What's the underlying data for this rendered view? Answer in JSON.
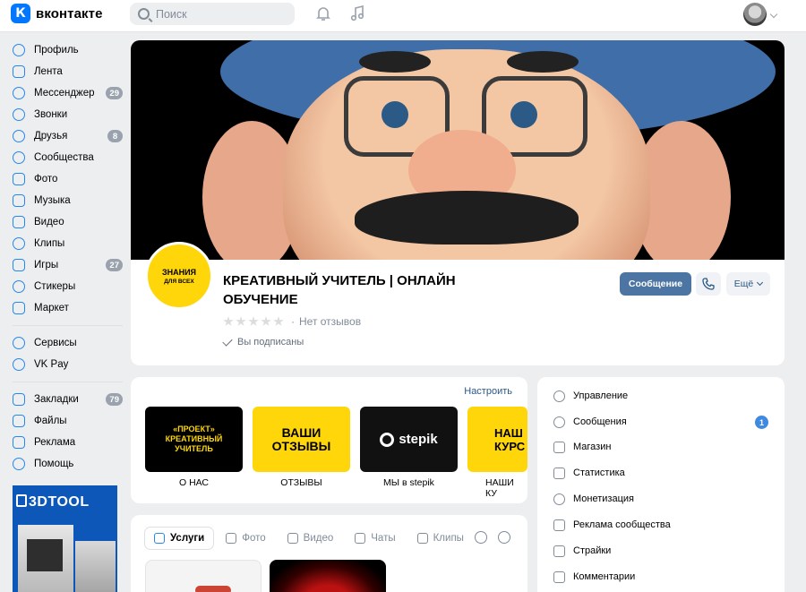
{
  "header": {
    "logo_text": "вконтакте",
    "logo_mark": "К",
    "search_placeholder": "Поиск",
    "icons": [
      "bell-icon",
      "music-note-icon",
      "chevron-down-icon"
    ]
  },
  "sidebar": {
    "items": [
      {
        "label": "Профиль",
        "icon": "user-circle-icon",
        "badge": ""
      },
      {
        "label": "Лента",
        "icon": "news-feed-icon",
        "badge": ""
      },
      {
        "label": "Мессенджер",
        "icon": "message-icon",
        "badge": "29"
      },
      {
        "label": "Звонки",
        "icon": "phone-icon",
        "badge": ""
      },
      {
        "label": "Друзья",
        "icon": "friends-icon",
        "badge": "8"
      },
      {
        "label": "Сообщества",
        "icon": "communities-icon",
        "badge": ""
      },
      {
        "label": "Фото",
        "icon": "photo-icon",
        "badge": ""
      },
      {
        "label": "Музыка",
        "icon": "music-icon",
        "badge": ""
      },
      {
        "label": "Видео",
        "icon": "video-icon",
        "badge": ""
      },
      {
        "label": "Клипы",
        "icon": "clips-icon",
        "badge": ""
      },
      {
        "label": "Игры",
        "icon": "games-icon",
        "badge": "27"
      },
      {
        "label": "Стикеры",
        "icon": "stickers-icon",
        "badge": ""
      },
      {
        "label": "Маркет",
        "icon": "market-icon",
        "badge": ""
      }
    ],
    "items2": [
      {
        "label": "Сервисы",
        "icon": "services-icon"
      },
      {
        "label": "VK Pay",
        "icon": "vk-pay-icon"
      }
    ],
    "items3": [
      {
        "label": "Закладки",
        "icon": "bookmark-icon",
        "badge": "79"
      },
      {
        "label": "Файлы",
        "icon": "file-icon",
        "badge": ""
      },
      {
        "label": "Реклама",
        "icon": "megaphone-icon",
        "badge": ""
      },
      {
        "label": "Помощь",
        "icon": "help-icon",
        "badge": ""
      }
    ],
    "ad": {
      "brand": "3DTOOL"
    }
  },
  "group": {
    "avatar_line1": "ЗНАНИЯ",
    "avatar_line2": "ДЛЯ ВСЕХ",
    "title": "КРЕАТИВНЫЙ УЧИТЕЛЬ | ОНЛАЙН ОБУЧЕНИЕ",
    "rating_stars": 0,
    "rating_sep": "·",
    "rating_text": "Нет отзывов",
    "subscribed_text": "Вы подписаны",
    "message_button": "Сообщение",
    "more_button": "Ещё"
  },
  "links": {
    "configure": "Настроить",
    "tile1_lines": [
      "«ПРОЕКТ»",
      "КРЕАТИВНЫЙ",
      "УЧИТЕЛЬ"
    ],
    "tile2_lines": [
      "ВАШИ",
      "ОТЗЫВЫ"
    ],
    "tile3_text": "stepik",
    "tile4_lines": [
      "НАШ",
      "КУРС"
    ],
    "labels": [
      "О НАС",
      "ОТЗЫВЫ",
      "МЫ в stepik",
      "НАШИ КУ"
    ]
  },
  "tabs": [
    {
      "label": "Услуги",
      "icon": "services-check-icon",
      "active": true
    },
    {
      "label": "Фото",
      "icon": "photo-icon",
      "active": false
    },
    {
      "label": "Видео",
      "icon": "video-icon",
      "active": false
    },
    {
      "label": "Чаты",
      "icon": "chats-icon",
      "active": false
    },
    {
      "label": "Клипы",
      "icon": "clips-icon",
      "active": false
    }
  ],
  "manage_menu": [
    {
      "label": "Управление",
      "icon": "gear-icon",
      "badge": ""
    },
    {
      "label": "Сообщения",
      "icon": "message-icon",
      "badge": "1"
    },
    {
      "label": "Магазин",
      "icon": "shop-bag-icon",
      "badge": ""
    },
    {
      "label": "Статистика",
      "icon": "stats-icon",
      "badge": ""
    },
    {
      "label": "Монетизация",
      "icon": "monetization-icon",
      "badge": ""
    },
    {
      "label": "Реклама сообщества",
      "icon": "megaphone-icon",
      "badge": ""
    },
    {
      "label": "Страйки",
      "icon": "warning-icon",
      "badge": ""
    },
    {
      "label": "Комментарии",
      "icon": "comment-icon",
      "badge": ""
    }
  ],
  "colors": {
    "accent": "#2688eb",
    "button": "#4c75a3",
    "yellow": "#ffd60a"
  }
}
